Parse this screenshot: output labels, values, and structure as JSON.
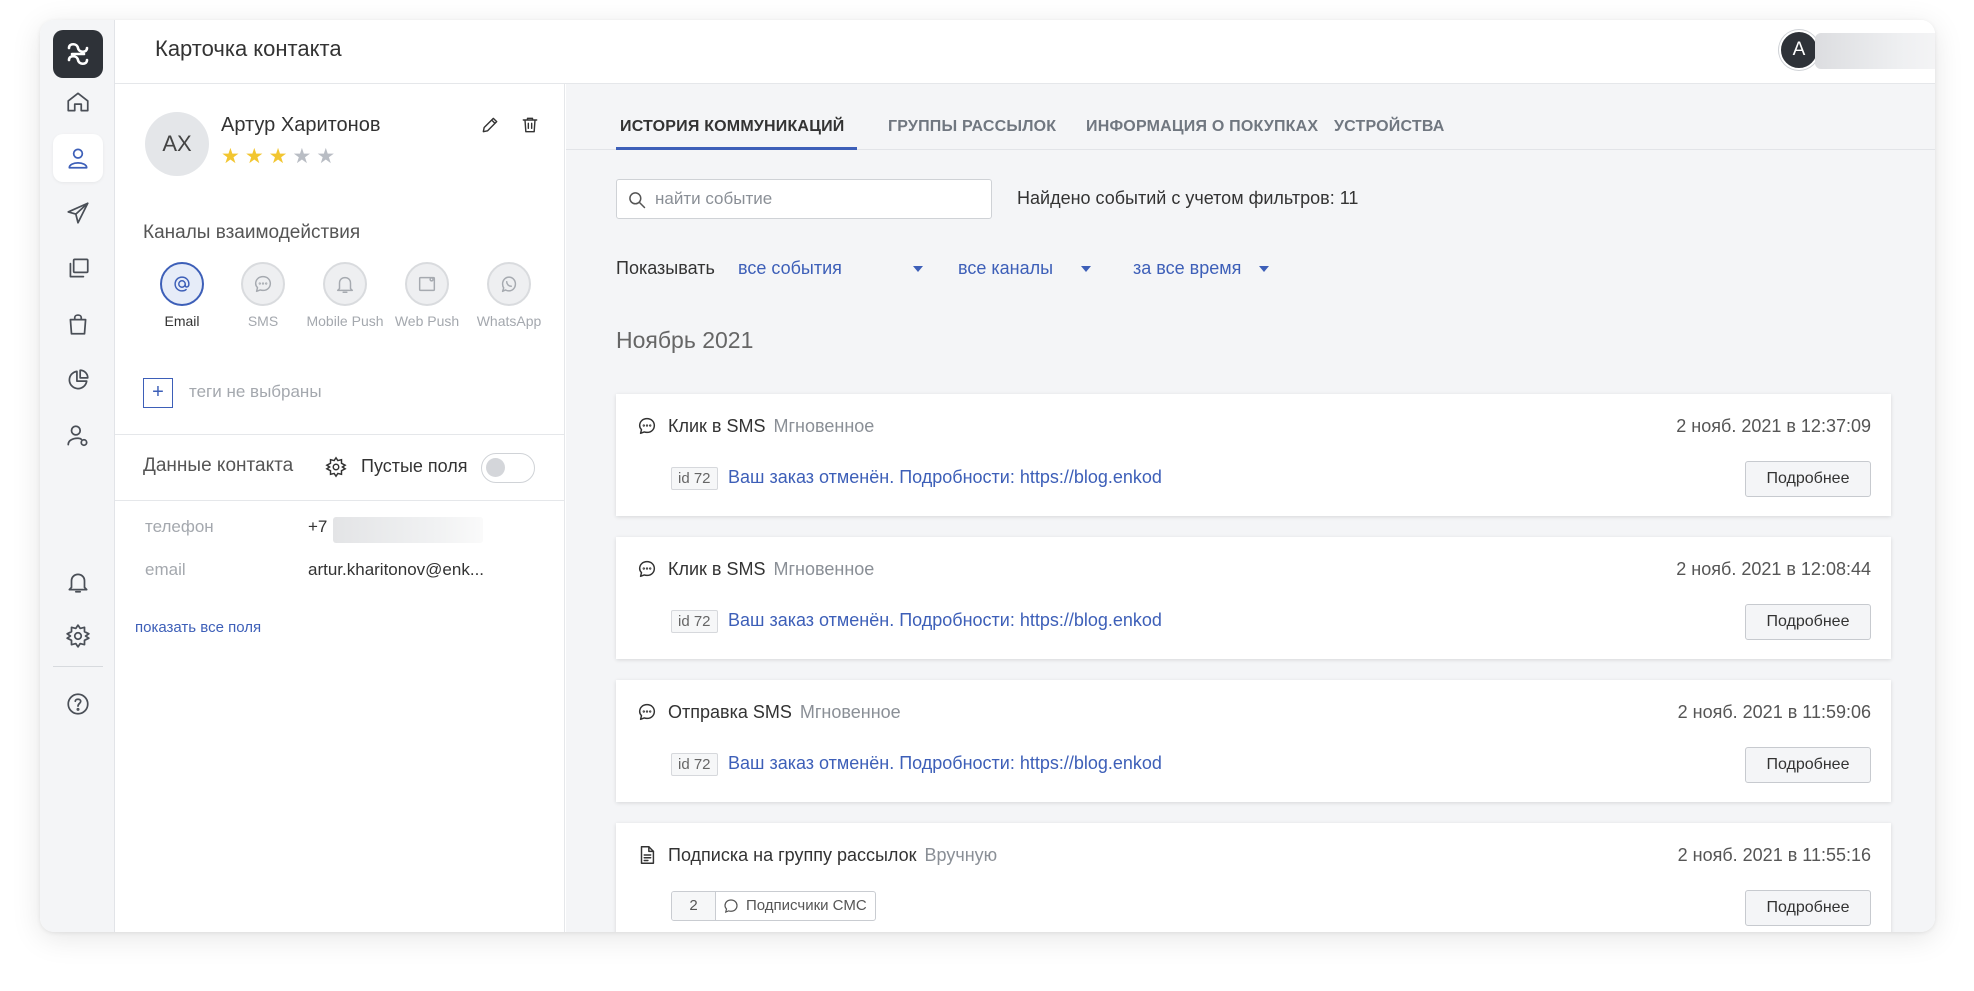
{
  "header": {
    "title": "Карточка контакта",
    "user_initial": "A"
  },
  "contact": {
    "initials": "АХ",
    "name": "Артур Харитонов",
    "rating": 3,
    "rating_max": 5
  },
  "channels": {
    "title": "Каналы взаимодействия",
    "items": [
      {
        "label": "Email",
        "icon": "at-icon",
        "active": true
      },
      {
        "label": "SMS",
        "icon": "chat-bubble-icon",
        "active": false
      },
      {
        "label": "Mobile Push",
        "icon": "bell-icon",
        "active": false
      },
      {
        "label": "Web Push",
        "icon": "browser-window-icon",
        "active": false
      },
      {
        "label": "WhatsApp",
        "icon": "whatsapp-icon",
        "active": false
      }
    ]
  },
  "tags": {
    "plus": "+",
    "empty_text": "теги не выбраны"
  },
  "contact_data": {
    "title": "Данные контакта",
    "empty_fields_label": "Пустые поля",
    "fields": [
      {
        "label": "телефон",
        "value": "+7"
      },
      {
        "label": "email",
        "value": "artur.kharitonov@enk..."
      }
    ],
    "show_all": "показать все поля"
  },
  "tabs": [
    {
      "label": "ИСТОРИЯ КОММУНИКАЦИЙ",
      "active": true
    },
    {
      "label": "ГРУППЫ РАССЫЛОК",
      "active": false
    },
    {
      "label": "ИНФОРМАЦИЯ О ПОКУПКАХ",
      "active": false
    },
    {
      "label": "УСТРОЙСТВА",
      "active": false
    }
  ],
  "search": {
    "placeholder": "найти событие"
  },
  "found_text": "Найдено событий с учетом фильтров: 11",
  "filters": {
    "label": "Показывать",
    "events": "все события",
    "channels": "все каналы",
    "period": "за все время"
  },
  "month": "Ноябрь 2021",
  "events": [
    {
      "icon": "chat-bubble-icon",
      "title": "Клик в SMS",
      "mode": "Мгновенное",
      "date": "2 нояб. 2021 в 12:37:09",
      "badge": "id 72",
      "message": "Ваш заказ отменён. Подробности: https://blog.enkod",
      "button": "Подробнее"
    },
    {
      "icon": "chat-bubble-icon",
      "title": "Клик в SMS",
      "mode": "Мгновенное",
      "date": "2 нояб. 2021 в 12:08:44",
      "badge": "id 72",
      "message": "Ваш заказ отменён. Подробности: https://blog.enkod",
      "button": "Подробнее"
    },
    {
      "icon": "chat-bubble-icon",
      "title": "Отправка SMS",
      "mode": "Мгновенное",
      "date": "2 нояб. 2021 в 11:59:06",
      "badge": "id 72",
      "message": "Ваш заказ отменён. Подробности: https://blog.enkod",
      "button": "Подробнее"
    },
    {
      "icon": "document-icon",
      "title": "Подписка на группу рассылок",
      "mode": "Вручную",
      "date": "2 нояб. 2021 в 11:55:16",
      "group_count": "2",
      "group_name": "Подписчики СМС",
      "button": "Подробнее"
    }
  ],
  "colors": {
    "accent": "#3d5fb8",
    "star": "#f2c631",
    "sidebar_dark": "#2e3238"
  }
}
